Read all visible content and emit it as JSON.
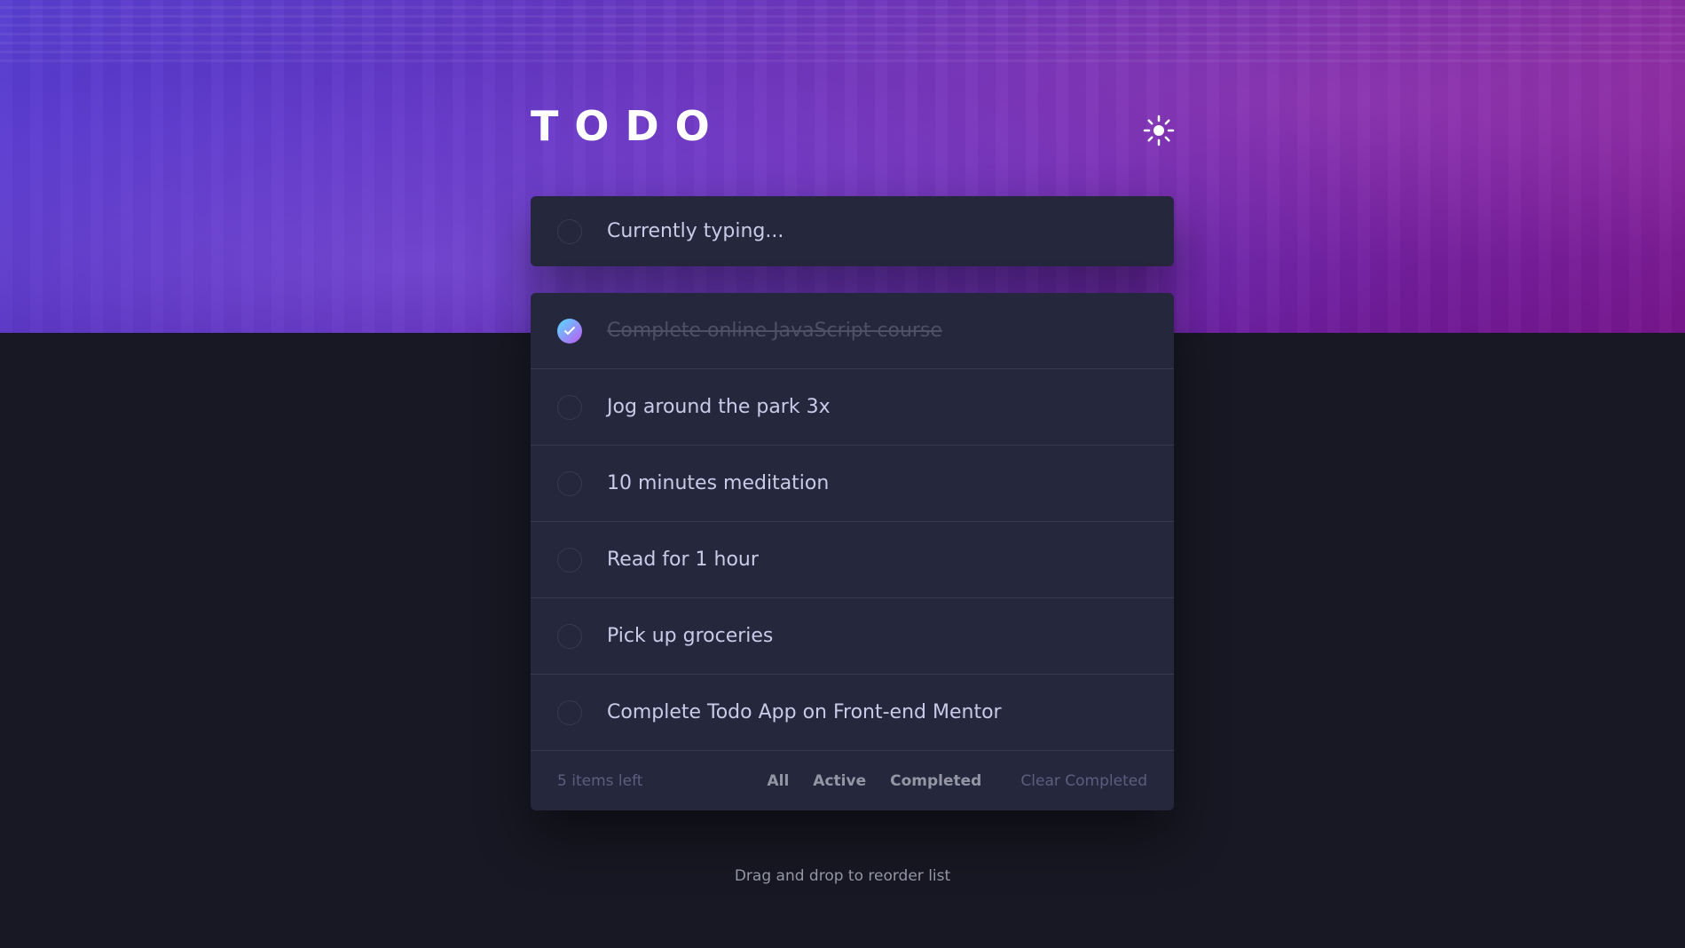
{
  "header": {
    "title": "TODO",
    "theme_toggle_icon": "sun-icon"
  },
  "new_todo": {
    "placeholder": "Currently typing..."
  },
  "todos": [
    {
      "text": "Complete online JavaScript course",
      "completed": true
    },
    {
      "text": "Jog around the park 3x",
      "completed": false
    },
    {
      "text": "10 minutes meditation",
      "completed": false
    },
    {
      "text": "Read for 1 hour",
      "completed": false
    },
    {
      "text": "Pick up groceries",
      "completed": false
    },
    {
      "text": "Complete Todo App on Front-end Mentor",
      "completed": false
    }
  ],
  "footer": {
    "items_left": "5 items left",
    "filters": [
      "All",
      "Active",
      "Completed"
    ],
    "clear_label": "Clear Completed"
  },
  "hint": "Drag and drop to reorder list",
  "colors": {
    "page_bg": "#171823",
    "card_bg": "#25273D",
    "text": "#C8CBE7",
    "muted": "#5B5E7E",
    "divider": "#393A4B",
    "check_gradient_start": "#55DDFF",
    "check_gradient_end": "#C058F3"
  }
}
